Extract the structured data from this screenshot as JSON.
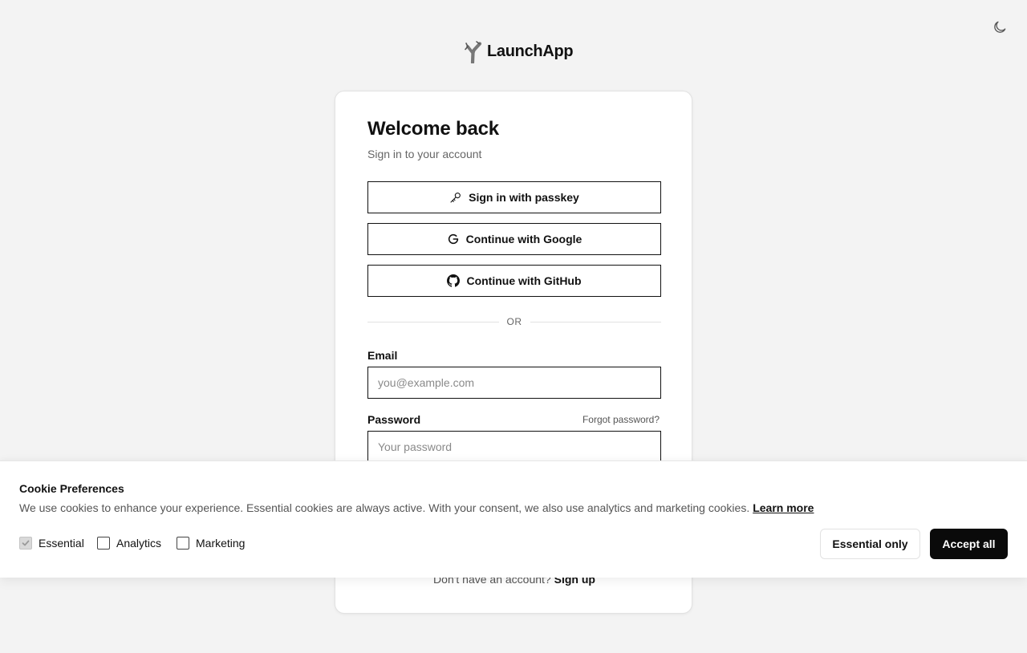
{
  "brand": {
    "name": "LaunchApp",
    "logo_icon": "slingshot-icon"
  },
  "header": {
    "theme_toggle_icon": "moon-icon"
  },
  "login": {
    "title": "Welcome back",
    "subtitle": "Sign in to your account",
    "passkey_label": "Sign in with passkey",
    "google_label": "Continue with Google",
    "github_label": "Continue with GitHub",
    "divider_text": "OR",
    "email_label": "Email",
    "email_placeholder": "you@example.com",
    "email_value": "",
    "password_label": "Password",
    "password_placeholder": "Your password",
    "password_value": "",
    "forgot_label": "Forgot password?",
    "signup_prompt": "Don't have an account?",
    "signup_link": "Sign up"
  },
  "cookie_banner": {
    "title": "Cookie Preferences",
    "text": "We use cookies to enhance your experience. Essential cookies are always active. With your consent, we also use analytics and marketing cookies.",
    "learn_more": "Learn more",
    "options": [
      {
        "label": "Essential",
        "checked": true,
        "disabled": true
      },
      {
        "label": "Analytics",
        "checked": false,
        "disabled": false
      },
      {
        "label": "Marketing",
        "checked": false,
        "disabled": false
      }
    ],
    "essential_only_label": "Essential only",
    "accept_all_label": "Accept all"
  },
  "colors": {
    "background": "#f3f3f3",
    "card": "#ffffff",
    "primary": "#0a0a0a",
    "muted_text": "#666666"
  }
}
